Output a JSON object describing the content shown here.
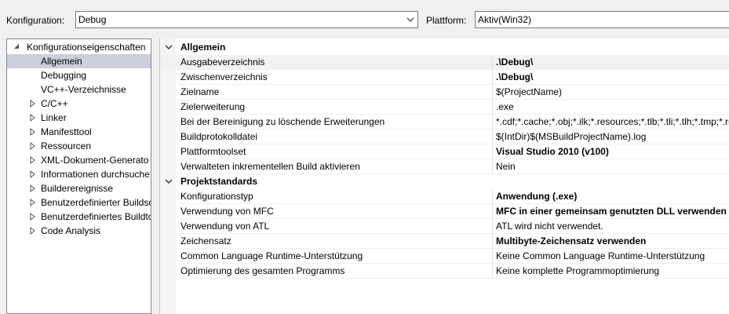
{
  "toolbar": {
    "config_label": "Konfiguration:",
    "config_value": "Debug",
    "platform_label": "Plattform:",
    "platform_value": "Aktiv(Win32)"
  },
  "tree": {
    "root": "Konfigurationseigenschaften",
    "items": [
      {
        "label": "Allgemein",
        "expandable": false,
        "selected": true
      },
      {
        "label": "Debugging",
        "expandable": false
      },
      {
        "label": "VC++-Verzeichnisse",
        "expandable": false
      },
      {
        "label": "C/C++",
        "expandable": true
      },
      {
        "label": "Linker",
        "expandable": true
      },
      {
        "label": "Manifesttool",
        "expandable": true
      },
      {
        "label": "Ressourcen",
        "expandable": true
      },
      {
        "label": "XML-Dokument-Generato",
        "expandable": true
      },
      {
        "label": "Informationen durchsuche",
        "expandable": true
      },
      {
        "label": "Builderereignisse",
        "expandable": true
      },
      {
        "label": "Benutzerdefinierter Buildsc",
        "expandable": true
      },
      {
        "label": "Benutzerdefiniertes Buildtc",
        "expandable": true
      },
      {
        "label": "Code Analysis",
        "expandable": true
      }
    ]
  },
  "grid": {
    "categories": [
      {
        "name": "Allgemein",
        "rows": [
          {
            "name": "Ausgabeverzeichnis",
            "value": ".\\Debug\\",
            "bold": true,
            "selected": true
          },
          {
            "name": "Zwischenverzeichnis",
            "value": ".\\Debug\\",
            "bold": true
          },
          {
            "name": "Zielname",
            "value": "$(ProjectName)"
          },
          {
            "name": "Zielerweiterung",
            "value": ".exe"
          },
          {
            "name": "Bei der Bereinigung zu löschende Erweiterungen",
            "value": "*.cdf;*.cache;*.obj;*.ilk;*.resources;*.tlb;*.tli;*.tlh;*.tmp;*.rsp;*.pgc;*.pgd;*.meta;*.tlog;*.manifest;*.res;*.pch;*.exp;*.idb;*.rep;*.xdc;*.pdb;*_manifest.rc;*.bsc;*.sbr;*.xml"
          },
          {
            "name": "Buildprotokolldatei",
            "value": "$(IntDir)$(MSBuildProjectName).log"
          },
          {
            "name": "Plattformtoolset",
            "value": "Visual Studio 2010 (v100)",
            "bold": true
          },
          {
            "name": "Verwalteten inkrementellen Build aktivieren",
            "value": "Nein"
          }
        ]
      },
      {
        "name": "Projektstandards",
        "rows": [
          {
            "name": "Konfigurationstyp",
            "value": "Anwendung (.exe)",
            "bold": true
          },
          {
            "name": "Verwendung von MFC",
            "value": "MFC in einer gemeinsam genutzten DLL verwenden",
            "bold": true
          },
          {
            "name": "Verwendung von ATL",
            "value": "ATL wird nicht verwendet."
          },
          {
            "name": "Zeichensatz",
            "value": "Multibyte-Zeichensatz verwenden",
            "bold": true
          },
          {
            "name": "Common Language Runtime-Unterstützung",
            "value": "Keine Common Language Runtime-Unterstützung"
          },
          {
            "name": "Optimierung des gesamten Programms",
            "value": "Keine komplette Programmoptimierung"
          }
        ]
      }
    ]
  },
  "icons": {
    "dropdown": "chevron-down-icon",
    "expanded": "triangle-down-icon",
    "collapsed": "triangle-right-icon"
  }
}
